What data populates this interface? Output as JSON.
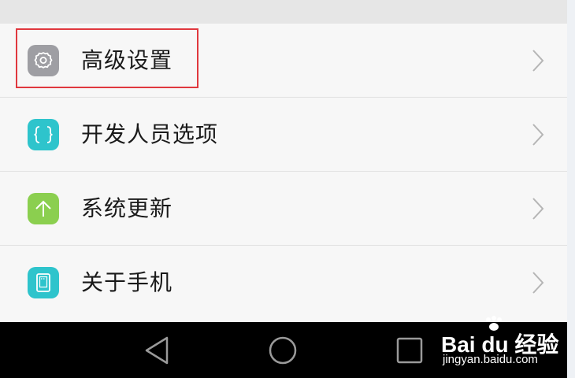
{
  "settings": {
    "items": [
      {
        "label": "高级设置",
        "icon": "gear-icon",
        "icon_color": "#9e9ea3"
      },
      {
        "label": "开发人员选项",
        "icon": "braces-icon",
        "icon_color": "#2ec4cc"
      },
      {
        "label": "系统更新",
        "icon": "arrow-up-icon",
        "icon_color": "#8bcf4f"
      },
      {
        "label": "关于手机",
        "icon": "phone-icon",
        "icon_color": "#2ec4cc"
      }
    ]
  },
  "highlight": {
    "color": "#e0383e"
  },
  "watermark": {
    "logo": "Bai du 经验",
    "url": "jingyan.baidu.com"
  },
  "navbar": {
    "buttons": [
      "back-icon",
      "home-icon",
      "recents-icon"
    ]
  }
}
